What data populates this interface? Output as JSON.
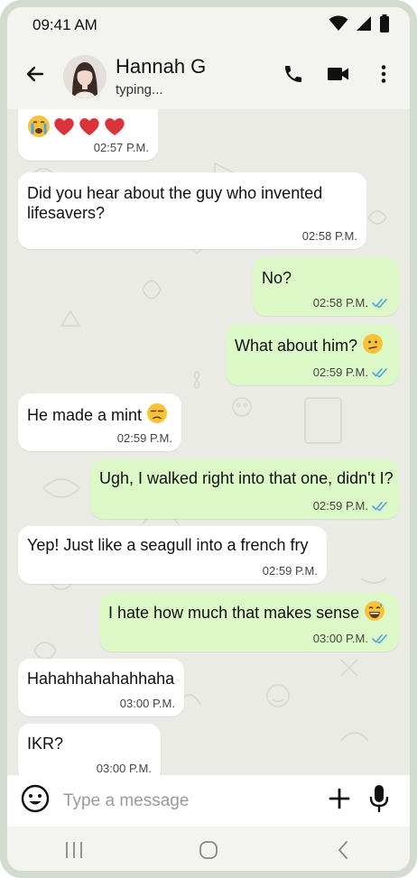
{
  "status_bar": {
    "time": "09:41 AM",
    "icons": [
      "wifi-icon",
      "cellular-signal-icon",
      "battery-icon"
    ]
  },
  "header": {
    "back_icon": "arrow-left-icon",
    "contact_name": "Hannah G",
    "contact_status": "typing...",
    "actions": [
      "phone-icon",
      "video-camera-icon",
      "more-vertical-icon"
    ]
  },
  "messages": [
    {
      "direction": "incoming",
      "text": "",
      "emojis": [
        "crying-face",
        "red-heart",
        "red-heart",
        "red-heart"
      ],
      "time": "02:57 P.M."
    },
    {
      "direction": "incoming",
      "text": "Did you hear about the guy who invented lifesavers?",
      "time": "02:58 P.M."
    },
    {
      "direction": "outgoing",
      "text": "No?",
      "time": "02:58 P.M.",
      "read": true
    },
    {
      "direction": "outgoing",
      "text": "What about him?",
      "emoji": "confused-face",
      "time": "02:59 P.M.",
      "read": true
    },
    {
      "direction": "incoming",
      "text": "He made a mint",
      "emoji": "unamused-face",
      "time": "02:59 P.M."
    },
    {
      "direction": "outgoing",
      "text": "Ugh, I walked right into that one, didn't I?",
      "time": "02:59 P.M.",
      "read": true
    },
    {
      "direction": "incoming",
      "text": "Yep! Just like a seagull into a french fry",
      "time": "02:59 P.M."
    },
    {
      "direction": "outgoing",
      "text": "I hate how much that makes sense",
      "emoji": "grinning-face-with-sweat",
      "time": "03:00 P.M.",
      "read": true
    },
    {
      "direction": "incoming",
      "text": "Hahahhahahahhaha",
      "time": "03:00 P.M."
    },
    {
      "direction": "incoming",
      "text": "IKR?",
      "time": "03:00 P.M."
    }
  ],
  "composer": {
    "placeholder": "Type a message",
    "emoji_icon": "smiley-icon",
    "attach_icon": "plus-icon",
    "mic_icon": "microphone-icon"
  },
  "nav_bar": [
    "recents-icon",
    "home-icon",
    "back-chevron-icon"
  ],
  "colors": {
    "outgoing_bubble": "#dcf8c6",
    "incoming_bubble": "#ffffff",
    "chat_background": "#ebebe6",
    "read_ticks": "#4fa3e0",
    "frame": "#d2dbcf"
  }
}
